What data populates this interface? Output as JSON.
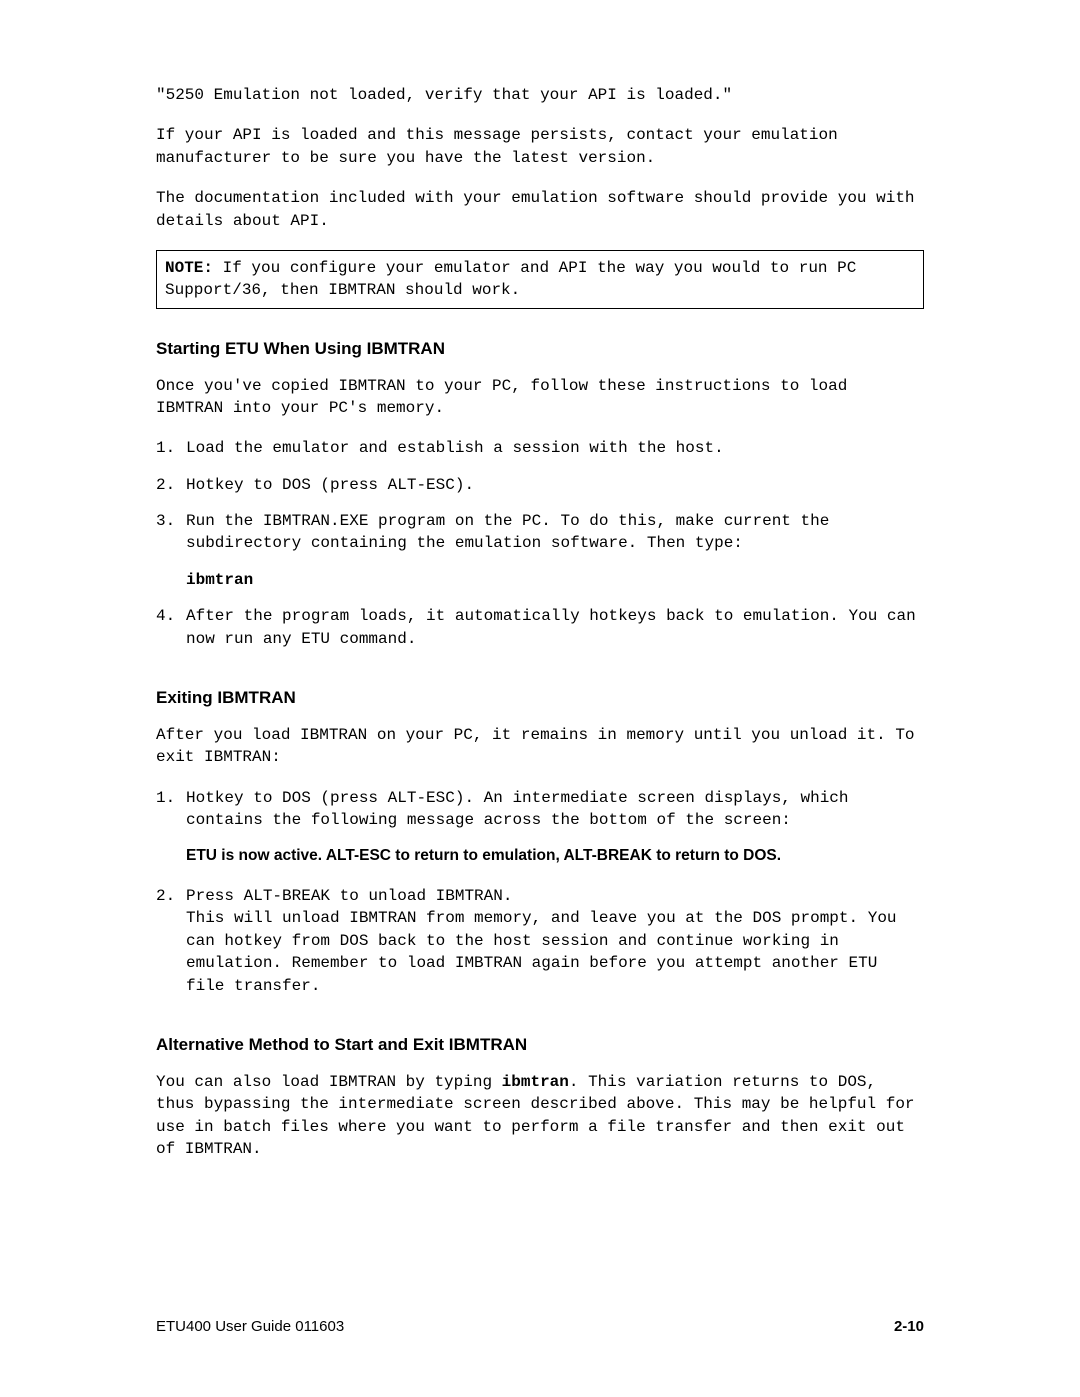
{
  "top": {
    "quoted_msg": "\"5250 Emulation not loaded, verify that your API is loaded.\"",
    "para1": "If your API is loaded and this message persists, contact your emulation manufacturer to be sure you have the latest version.",
    "para2": "The documentation included with your emulation software should provide you with details about API."
  },
  "note": {
    "label": "NOTE:",
    "text": " If you configure your emulator and API the way you would to run PC Support/36, then IBMTRAN should work."
  },
  "section1": {
    "heading": "Starting ETU When Using IBMTRAN",
    "intro": "Once you've copied IBMTRAN to your PC, follow these instructions to load IBMTRAN into your PC's memory.",
    "items": [
      {
        "num": "1.",
        "body": "Load the emulator and establish a session with the host."
      },
      {
        "num": "2.",
        "body": "Hotkey to DOS (press ALT-ESC)."
      },
      {
        "num": "3.",
        "body": "Run the IBMTRAN.EXE program on the PC. To do this, make current the subdirectory containing the emulation software. Then type:"
      }
    ],
    "cmd": "ibmtran",
    "item4": {
      "num": "4.",
      "body": "After the program loads, it automatically hotkeys back to emulation. You can now run any ETU command."
    }
  },
  "section2": {
    "heading": "Exiting IBMTRAN",
    "intro": "After you load IBMTRAN on your PC, it remains in memory until you unload it. To exit IBMTRAN:",
    "item1": {
      "num": "1.",
      "body": "Hotkey to DOS (press ALT-ESC). An intermediate screen displays, which contains the following message across the bottom of the screen:"
    },
    "bold_line": "ETU is now active. ALT-ESC to return to emulation, ALT-BREAK to return to DOS.",
    "item2": {
      "num": "2.",
      "line1": "Press ALT-BREAK to unload IBMTRAN.",
      "line2": "This will unload IBMTRAN from memory, and leave you at the DOS prompt. You can hotkey from DOS back to the host session and continue working in emulation. Remember to load IMBTRAN again before you attempt another ETU file transfer."
    }
  },
  "section3": {
    "heading": "Alternative Method to Start and Exit IBMTRAN",
    "para_pre": "You can also load IBMTRAN by typing ",
    "para_cmd": "ibmtran",
    "para_post": ". This variation returns to DOS, thus bypassing the intermediate screen described above. This may be helpful for use in batch files where you want to perform a file transfer and then exit out of IBMTRAN."
  },
  "footer": {
    "left": "ETU400 User Guide 011603",
    "right": "2-10"
  }
}
